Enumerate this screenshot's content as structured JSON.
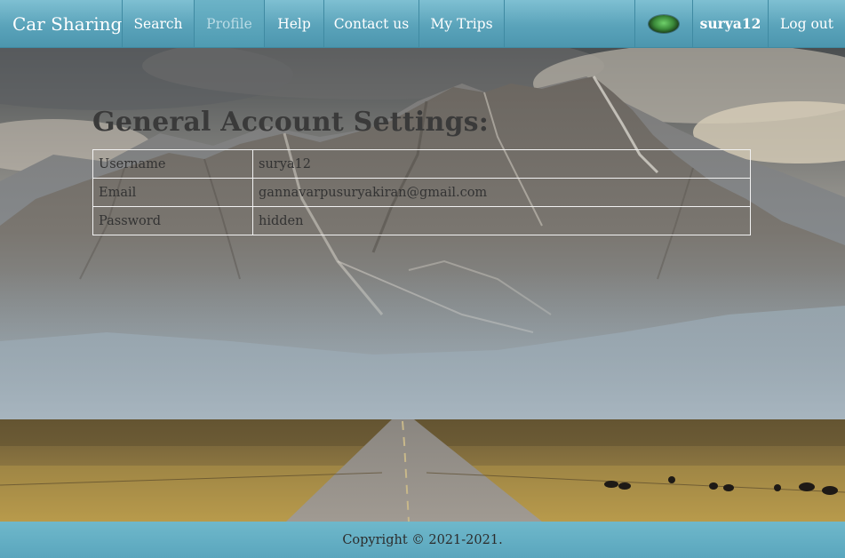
{
  "navbar": {
    "brand": "Car Sharing",
    "items": [
      {
        "label": "Search"
      },
      {
        "label": "Profile"
      },
      {
        "label": "Help"
      },
      {
        "label": "Contact us"
      },
      {
        "label": "My Trips"
      }
    ],
    "active_item": "Profile",
    "username": "surya12",
    "logout_label": "Log out"
  },
  "settings": {
    "title": "General Account Settings:",
    "rows": [
      {
        "label": "Username",
        "value": "surya12"
      },
      {
        "label": "Email",
        "value": "gannavarpusuryakiran@gmail.com"
      },
      {
        "label": "Password",
        "value": "hidden"
      }
    ]
  },
  "footer": {
    "copyright": "Copyright © 2021-2021."
  },
  "colors": {
    "nav_bg": "#5aa3ba",
    "nav_text": "#ffffff",
    "active_text": "#b9dbe5",
    "footer_bg": "#5aa6bd",
    "title_text": "#3a3a3a"
  }
}
